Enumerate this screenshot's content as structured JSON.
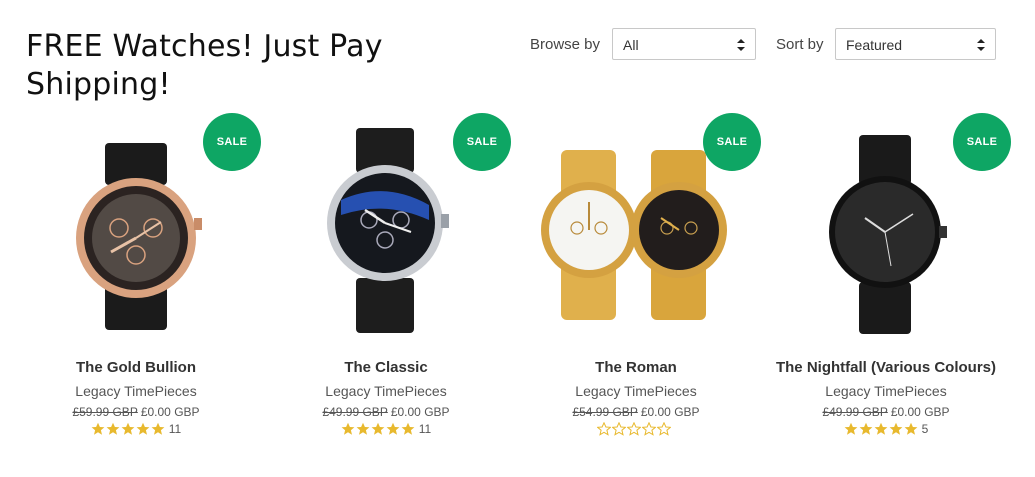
{
  "page": {
    "title": "FREE Watches! Just Pay Shipping!"
  },
  "filters": {
    "browse_label": "Browse by",
    "browse_value": "All",
    "sort_label": "Sort by",
    "sort_value": "Featured"
  },
  "colors": {
    "sale_badge": "#0ea664",
    "star_filled": "#e8b92e",
    "star_empty_stroke": "#e8b92e"
  },
  "products": [
    {
      "badge": "SALE",
      "name": "The Gold Bullion",
      "vendor": "Legacy TimePieces",
      "old_price": "£59.99 GBP",
      "price": "£0.00 GBP",
      "stars": 5,
      "reviews": "11",
      "image": "rose-gold-watch-black-strap"
    },
    {
      "badge": "SALE",
      "name": "The Classic",
      "vendor": "Legacy TimePieces",
      "old_price": "£49.99 GBP",
      "price": "£0.00 GBP",
      "stars": 5,
      "reviews": "11",
      "image": "silver-blue-watch-black-strap"
    },
    {
      "badge": "SALE",
      "name": "The Roman",
      "vendor": "Legacy TimePieces",
      "old_price": "£54.99 GBP",
      "price": "£0.00 GBP",
      "stars": 0,
      "reviews": "",
      "image": "gold-watch-pair"
    },
    {
      "badge": "SALE",
      "name": "The Nightfall (Various Colours)",
      "vendor": "Legacy TimePieces",
      "old_price": "£49.99 GBP",
      "price": "£0.00 GBP",
      "stars": 5,
      "reviews": "5",
      "image": "black-minimal-watch"
    }
  ]
}
